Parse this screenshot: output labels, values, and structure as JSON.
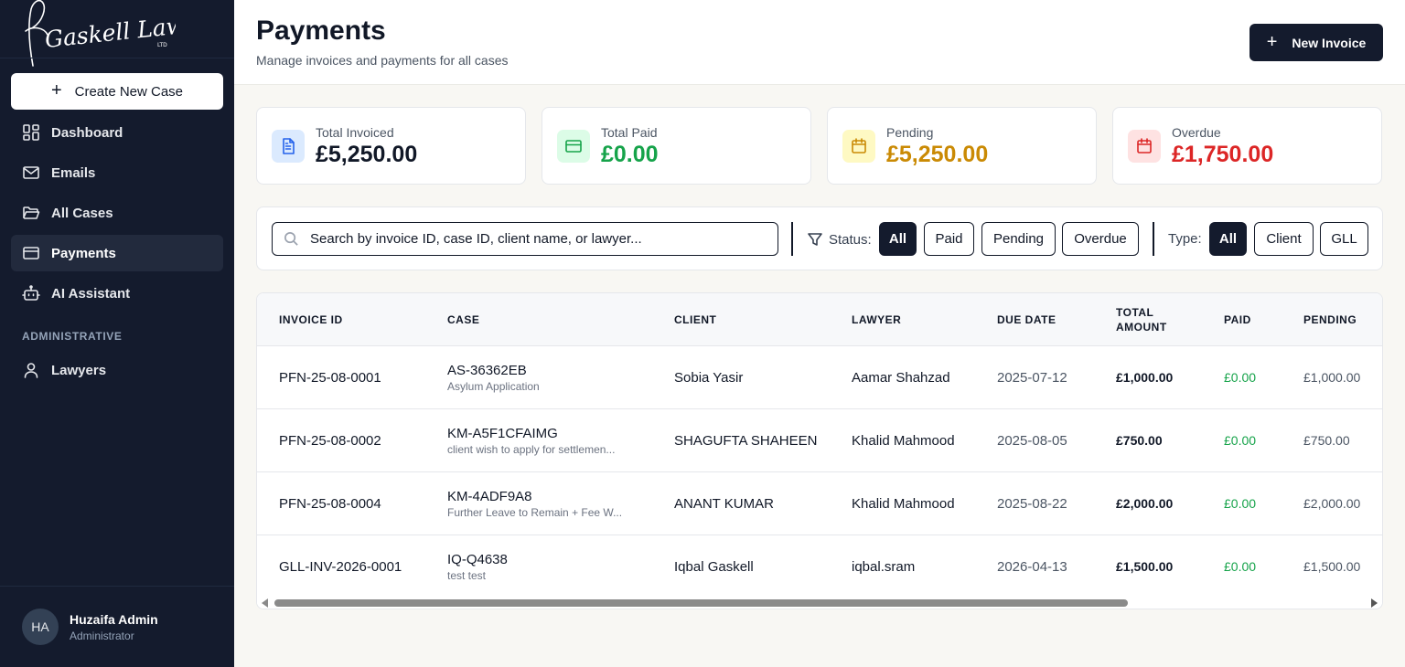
{
  "sidebar": {
    "logo_text": "Gaskell Law LTD",
    "create_label": "Create New Case",
    "items": [
      {
        "label": "Dashboard",
        "icon": "dashboard-icon"
      },
      {
        "label": "Emails",
        "icon": "mail-icon"
      },
      {
        "label": "All Cases",
        "icon": "folder-icon"
      },
      {
        "label": "Payments",
        "icon": "credit-card-icon",
        "active": true
      },
      {
        "label": "AI Assistant",
        "icon": "bot-icon"
      }
    ],
    "section_label": "ADMINISTRATIVE",
    "admin_items": [
      {
        "label": "Lawyers",
        "icon": "user-icon"
      }
    ],
    "user": {
      "initials": "HA",
      "name": "Huzaifa Admin",
      "role": "Administrator"
    }
  },
  "header": {
    "title": "Payments",
    "subtitle": "Manage invoices and payments for all cases",
    "new_invoice_label": "New Invoice"
  },
  "stats": [
    {
      "label": "Total Invoiced",
      "value": "£5,250.00",
      "icon": "document-icon",
      "color": "#111827",
      "icon_bg": "#dbeafe",
      "icon_color": "#2563eb"
    },
    {
      "label": "Total Paid",
      "value": "£0.00",
      "icon": "credit-card-icon",
      "color": "#16a34a",
      "icon_bg": "#dcfce7",
      "icon_color": "#16a34a"
    },
    {
      "label": "Pending",
      "value": "£5,250.00",
      "icon": "calendar-icon",
      "color": "#ca8a04",
      "icon_bg": "#fef9c3",
      "icon_color": "#ca8a04"
    },
    {
      "label": "Overdue",
      "value": "£1,750.00",
      "icon": "calendar-icon",
      "color": "#dc2626",
      "icon_bg": "#fee2e2",
      "icon_color": "#dc2626"
    }
  ],
  "filters": {
    "search_placeholder": "Search by invoice ID, case ID, client name, or lawyer...",
    "status_label": "Status:",
    "status_options": [
      "All",
      "Paid",
      "Pending",
      "Overdue"
    ],
    "status_selected": "All",
    "type_label": "Type:",
    "type_options": [
      "All",
      "Client",
      "GLL"
    ],
    "type_selected": "All"
  },
  "table": {
    "columns": [
      "INVOICE ID",
      "CASE",
      "CLIENT",
      "LAWYER",
      "DUE DATE",
      "TOTAL AMOUNT",
      "PAID",
      "PENDING"
    ],
    "rows": [
      {
        "invoice_id": "PFN-25-08-0001",
        "case_id": "AS-36362EB",
        "case_desc": "Asylum Application",
        "client": "Sobia Yasir",
        "lawyer": "Aamar Shahzad",
        "due_date": "2025-07-12",
        "total": "£1,000.00",
        "paid": "£0.00",
        "pending": "£1,000.00"
      },
      {
        "invoice_id": "PFN-25-08-0002",
        "case_id": "KM-A5F1CFAIMG",
        "case_desc": "client wish to apply for settlemen...",
        "client": "SHAGUFTA SHAHEEN",
        "lawyer": "Khalid Mahmood",
        "due_date": "2025-08-05",
        "total": "£750.00",
        "paid": "£0.00",
        "pending": "£750.00"
      },
      {
        "invoice_id": "PFN-25-08-0004",
        "case_id": "KM-4ADF9A8",
        "case_desc": "Further Leave to Remain + Fee W...",
        "client": "ANANT KUMAR",
        "lawyer": "Khalid Mahmood",
        "due_date": "2025-08-22",
        "total": "£2,000.00",
        "paid": "£0.00",
        "pending": "£2,000.00"
      },
      {
        "invoice_id": "GLL-INV-2026-0001",
        "case_id": "IQ-Q4638",
        "case_desc": "test test",
        "client": "Iqbal Gaskell",
        "lawyer": "iqbal.sram",
        "due_date": "2026-04-13",
        "total": "£1,500.00",
        "paid": "£0.00",
        "pending": "£1,500.00"
      }
    ]
  }
}
